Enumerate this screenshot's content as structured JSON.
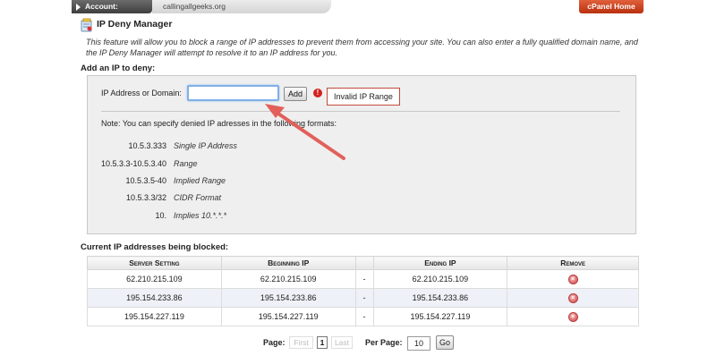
{
  "topbar": {
    "account_label": "Account:",
    "domain": "callingallgeeks.org",
    "cpanel_home": "cPanel Home"
  },
  "header": {
    "title": "IP Deny Manager",
    "description": "This feature will allow you to block a range of IP addresses to prevent them from accessing your site. You can also enter a fully qualified domain name, and the IP Deny Manager will attempt to resolve it to an IP address for you."
  },
  "add_section": {
    "heading": "Add an IP to deny:",
    "field_label": "IP Address or Domain:",
    "field_value": "",
    "add_button": "Add",
    "error_icon": "!",
    "error_message": "Invalid IP Range",
    "note": "Note: You can specify denied IP adresses in the following formats:",
    "formats": [
      {
        "ip": "10.5.3.333",
        "desc": "Single IP Address"
      },
      {
        "ip": "10.5.3.3-10.5.3.40",
        "desc": "Range"
      },
      {
        "ip": "10.5.3.5-40",
        "desc": "Implied Range"
      },
      {
        "ip": "10.5.3.3/32",
        "desc": "CIDR Format"
      },
      {
        "ip": "10.",
        "desc": "Implies 10.*.*.*"
      }
    ]
  },
  "blocked": {
    "heading": "Current IP addresses being blocked:",
    "columns": [
      "Server Setting",
      "Beginning IP",
      "",
      "Ending IP",
      "Remove"
    ],
    "rows": [
      {
        "setting": "62.210.215.109",
        "begin": "62.210.215.109",
        "sep": "-",
        "end": "62.210.215.109"
      },
      {
        "setting": "195.154.233.86",
        "begin": "195.154.233.86",
        "sep": "-",
        "end": "195.154.233.86"
      },
      {
        "setting": "195.154.227.119",
        "begin": "195.154.227.119",
        "sep": "-",
        "end": "195.154.227.119"
      }
    ],
    "remove_icon": "remove-icon"
  },
  "pagination": {
    "page_label": "Page:",
    "first": "First",
    "current": "1",
    "last": "Last",
    "per_page_label": "Per Page:",
    "per_page_value": "10",
    "go_button": "Go"
  },
  "colors": {
    "cpanel_button": "#c9421c",
    "error": "#d52020",
    "annotation_arrow": "#e2605a",
    "alt_row": "#eef1f7"
  }
}
